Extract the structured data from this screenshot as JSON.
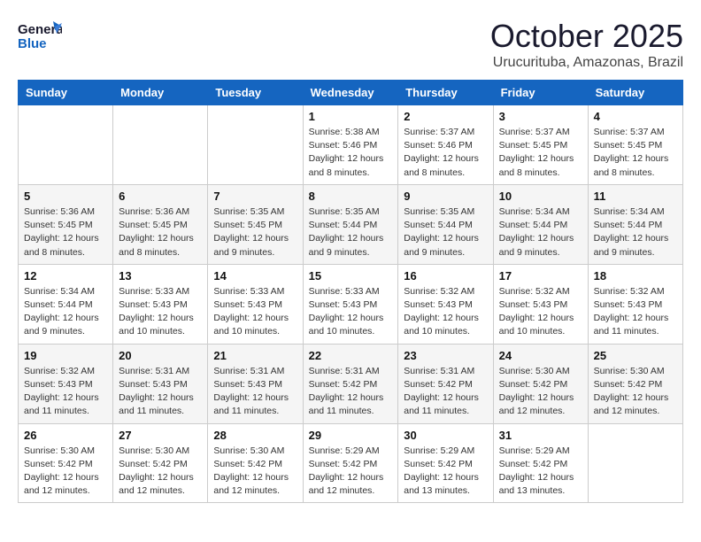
{
  "header": {
    "logo_general": "General",
    "logo_blue": "Blue",
    "month_title": "October 2025",
    "subtitle": "Urucurituba, Amazonas, Brazil"
  },
  "weekdays": [
    "Sunday",
    "Monday",
    "Tuesday",
    "Wednesday",
    "Thursday",
    "Friday",
    "Saturday"
  ],
  "weeks": [
    [
      {
        "day": "",
        "info": ""
      },
      {
        "day": "",
        "info": ""
      },
      {
        "day": "",
        "info": ""
      },
      {
        "day": "1",
        "info": "Sunrise: 5:38 AM\nSunset: 5:46 PM\nDaylight: 12 hours\nand 8 minutes."
      },
      {
        "day": "2",
        "info": "Sunrise: 5:37 AM\nSunset: 5:46 PM\nDaylight: 12 hours\nand 8 minutes."
      },
      {
        "day": "3",
        "info": "Sunrise: 5:37 AM\nSunset: 5:45 PM\nDaylight: 12 hours\nand 8 minutes."
      },
      {
        "day": "4",
        "info": "Sunrise: 5:37 AM\nSunset: 5:45 PM\nDaylight: 12 hours\nand 8 minutes."
      }
    ],
    [
      {
        "day": "5",
        "info": "Sunrise: 5:36 AM\nSunset: 5:45 PM\nDaylight: 12 hours\nand 8 minutes."
      },
      {
        "day": "6",
        "info": "Sunrise: 5:36 AM\nSunset: 5:45 PM\nDaylight: 12 hours\nand 8 minutes."
      },
      {
        "day": "7",
        "info": "Sunrise: 5:35 AM\nSunset: 5:45 PM\nDaylight: 12 hours\nand 9 minutes."
      },
      {
        "day": "8",
        "info": "Sunrise: 5:35 AM\nSunset: 5:44 PM\nDaylight: 12 hours\nand 9 minutes."
      },
      {
        "day": "9",
        "info": "Sunrise: 5:35 AM\nSunset: 5:44 PM\nDaylight: 12 hours\nand 9 minutes."
      },
      {
        "day": "10",
        "info": "Sunrise: 5:34 AM\nSunset: 5:44 PM\nDaylight: 12 hours\nand 9 minutes."
      },
      {
        "day": "11",
        "info": "Sunrise: 5:34 AM\nSunset: 5:44 PM\nDaylight: 12 hours\nand 9 minutes."
      }
    ],
    [
      {
        "day": "12",
        "info": "Sunrise: 5:34 AM\nSunset: 5:44 PM\nDaylight: 12 hours\nand 9 minutes."
      },
      {
        "day": "13",
        "info": "Sunrise: 5:33 AM\nSunset: 5:43 PM\nDaylight: 12 hours\nand 10 minutes."
      },
      {
        "day": "14",
        "info": "Sunrise: 5:33 AM\nSunset: 5:43 PM\nDaylight: 12 hours\nand 10 minutes."
      },
      {
        "day": "15",
        "info": "Sunrise: 5:33 AM\nSunset: 5:43 PM\nDaylight: 12 hours\nand 10 minutes."
      },
      {
        "day": "16",
        "info": "Sunrise: 5:32 AM\nSunset: 5:43 PM\nDaylight: 12 hours\nand 10 minutes."
      },
      {
        "day": "17",
        "info": "Sunrise: 5:32 AM\nSunset: 5:43 PM\nDaylight: 12 hours\nand 10 minutes."
      },
      {
        "day": "18",
        "info": "Sunrise: 5:32 AM\nSunset: 5:43 PM\nDaylight: 12 hours\nand 11 minutes."
      }
    ],
    [
      {
        "day": "19",
        "info": "Sunrise: 5:32 AM\nSunset: 5:43 PM\nDaylight: 12 hours\nand 11 minutes."
      },
      {
        "day": "20",
        "info": "Sunrise: 5:31 AM\nSunset: 5:43 PM\nDaylight: 12 hours\nand 11 minutes."
      },
      {
        "day": "21",
        "info": "Sunrise: 5:31 AM\nSunset: 5:43 PM\nDaylight: 12 hours\nand 11 minutes."
      },
      {
        "day": "22",
        "info": "Sunrise: 5:31 AM\nSunset: 5:42 PM\nDaylight: 12 hours\nand 11 minutes."
      },
      {
        "day": "23",
        "info": "Sunrise: 5:31 AM\nSunset: 5:42 PM\nDaylight: 12 hours\nand 11 minutes."
      },
      {
        "day": "24",
        "info": "Sunrise: 5:30 AM\nSunset: 5:42 PM\nDaylight: 12 hours\nand 12 minutes."
      },
      {
        "day": "25",
        "info": "Sunrise: 5:30 AM\nSunset: 5:42 PM\nDaylight: 12 hours\nand 12 minutes."
      }
    ],
    [
      {
        "day": "26",
        "info": "Sunrise: 5:30 AM\nSunset: 5:42 PM\nDaylight: 12 hours\nand 12 minutes."
      },
      {
        "day": "27",
        "info": "Sunrise: 5:30 AM\nSunset: 5:42 PM\nDaylight: 12 hours\nand 12 minutes."
      },
      {
        "day": "28",
        "info": "Sunrise: 5:30 AM\nSunset: 5:42 PM\nDaylight: 12 hours\nand 12 minutes."
      },
      {
        "day": "29",
        "info": "Sunrise: 5:29 AM\nSunset: 5:42 PM\nDaylight: 12 hours\nand 12 minutes."
      },
      {
        "day": "30",
        "info": "Sunrise: 5:29 AM\nSunset: 5:42 PM\nDaylight: 12 hours\nand 13 minutes."
      },
      {
        "day": "31",
        "info": "Sunrise: 5:29 AM\nSunset: 5:42 PM\nDaylight: 12 hours\nand 13 minutes."
      },
      {
        "day": "",
        "info": ""
      }
    ]
  ]
}
